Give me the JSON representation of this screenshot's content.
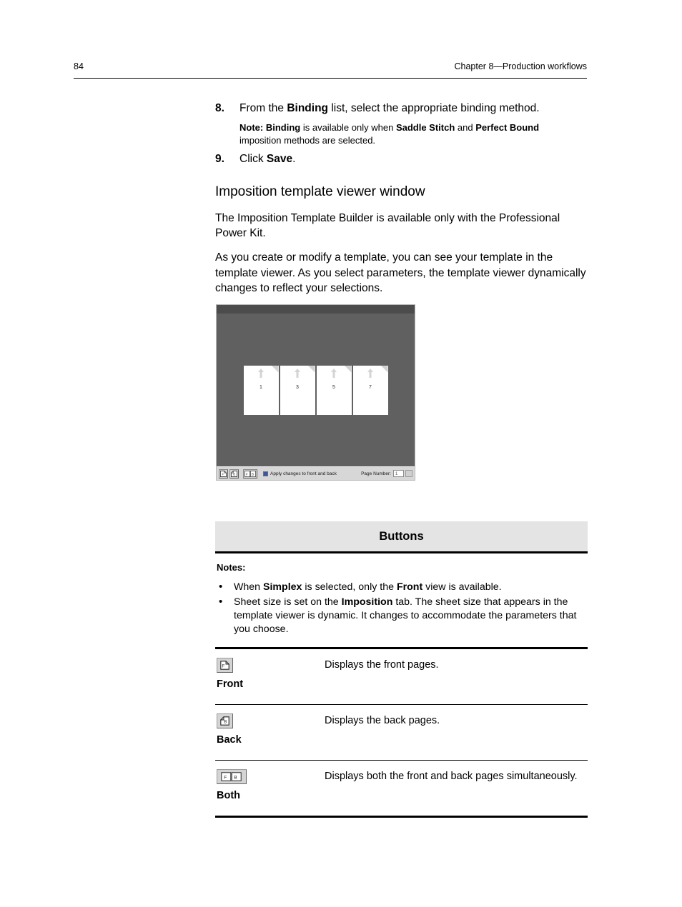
{
  "header": {
    "page_number": "84",
    "chapter": "Chapter 8—Production workflows"
  },
  "steps": [
    {
      "number": "8.",
      "segments": [
        {
          "text": "From the ",
          "bold": false
        },
        {
          "text": "Binding",
          "bold": true
        },
        {
          "text": " list, select the appropriate binding method.",
          "bold": false
        }
      ]
    }
  ],
  "step8_note": [
    {
      "text": "Note: ",
      "bold": true
    },
    {
      "text": "Binding",
      "bold": true
    },
    {
      "text": " is available only when ",
      "bold": false
    },
    {
      "text": "Saddle Stitch",
      "bold": true
    },
    {
      "text": " and ",
      "bold": false
    },
    {
      "text": "Perfect Bound",
      "bold": true
    },
    {
      "text": " imposition methods are selected.",
      "bold": false
    }
  ],
  "step9": {
    "number": "9.",
    "segments": [
      {
        "text": "Click ",
        "bold": false
      },
      {
        "text": "Save",
        "bold": true
      },
      {
        "text": ".",
        "bold": false
      }
    ]
  },
  "section": {
    "title": "Imposition template viewer window",
    "paragraph1": "The Imposition Template Builder is available only with the Professional Power Kit.",
    "paragraph2": "As you create or modify a template, you can see your template in the template viewer. As you select parameters, the template viewer dynamically changes to reflect your selections."
  },
  "figure": {
    "background_color": "#606060",
    "topbar_color": "#4c4c4c",
    "sheets": [
      {
        "page_label": "1"
      },
      {
        "page_label": "3"
      },
      {
        "page_label": "5"
      },
      {
        "page_label": "7"
      }
    ],
    "toolbar": {
      "buttons": [
        {
          "name": "front-view-button",
          "glyph": "F"
        },
        {
          "name": "back-view-button",
          "glyph": "B"
        },
        {
          "name": "both-view-button",
          "glyph": "FB"
        }
      ],
      "checkbox_label": "Apply changes to front and back",
      "checkbox_checked": true,
      "page_number_label": "Page Number:",
      "page_number_value": "1"
    }
  },
  "buttons_table": {
    "heading": "Buttons",
    "notes_title": "Notes:",
    "notes": [
      [
        {
          "text": "When ",
          "bold": false
        },
        {
          "text": "Simplex",
          "bold": true
        },
        {
          "text": " is selected, only the ",
          "bold": false
        },
        {
          "text": "Front",
          "bold": true
        },
        {
          "text": " view is available.",
          "bold": false
        }
      ],
      [
        {
          "text": "Sheet size is set on the ",
          "bold": false
        },
        {
          "text": "Imposition",
          "bold": true
        },
        {
          "text": " tab. The sheet size that appears in the template viewer is dynamic. It changes to accommodate the parameters that you choose.",
          "bold": false
        }
      ]
    ],
    "rows": [
      {
        "icon": "front-page-icon",
        "icon_glyph": "F",
        "label": "Front",
        "description": "Displays the front pages."
      },
      {
        "icon": "back-page-icon",
        "icon_glyph": "B",
        "label": "Back",
        "description": "Displays the back pages."
      },
      {
        "icon": "both-pages-icon",
        "icon_glyph": "F B",
        "label": "Both",
        "description": "Displays both the front and back pages simultaneously."
      }
    ]
  }
}
